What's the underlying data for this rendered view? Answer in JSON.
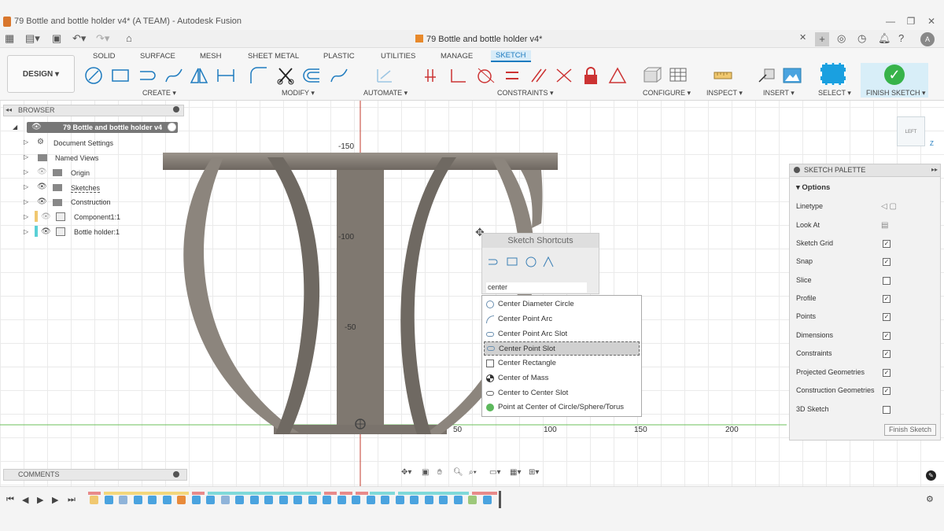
{
  "window": {
    "title": "79 Bottle and bottle holder v4* (A TEAM) - Autodesk Fusion"
  },
  "doc_tab": {
    "title": "79 Bottle and bottle holder v4*"
  },
  "ribbon": {
    "design_label": "DESIGN",
    "tabs": [
      "SOLID",
      "SURFACE",
      "MESH",
      "SHEET METAL",
      "PLASTIC",
      "UTILITIES",
      "MANAGE",
      "SKETCH"
    ],
    "active_tab": "SKETCH",
    "groups": [
      "CREATE",
      "MODIFY",
      "AUTOMATE",
      "CONSTRAINTS",
      "CONFIGURE",
      "INSPECT",
      "INSERT",
      "SELECT",
      "FINISH SKETCH"
    ]
  },
  "browser": {
    "title": "BROWSER",
    "root": "79 Bottle and bottle holder v4",
    "items": [
      "Document Settings",
      "Named Views",
      "Origin",
      "Sketches",
      "Construction",
      "Component1:1",
      "Bottle holder:1"
    ]
  },
  "comments": {
    "title": "COMMENTS"
  },
  "sketch_palette": {
    "title": "SKETCH PALETTE",
    "section": "Options",
    "rows": [
      {
        "label": "Linetype",
        "checked": null
      },
      {
        "label": "Look At",
        "checked": null
      },
      {
        "label": "Sketch Grid",
        "checked": true
      },
      {
        "label": "Snap",
        "checked": true
      },
      {
        "label": "Slice",
        "checked": false
      },
      {
        "label": "Profile",
        "checked": true
      },
      {
        "label": "Points",
        "checked": true
      },
      {
        "label": "Dimensions",
        "checked": true
      },
      {
        "label": "Constraints",
        "checked": true
      },
      {
        "label": "Projected Geometries",
        "checked": true
      },
      {
        "label": "Construction Geometries",
        "checked": true
      },
      {
        "label": "3D Sketch",
        "checked": false
      }
    ],
    "finish_label": "Finish Sketch"
  },
  "shortcuts": {
    "title": "Sketch Shortcuts",
    "search_value": "center",
    "results": [
      "Center Diameter Circle",
      "Center Point Arc",
      "Center Point Arc Slot",
      "Center Point Slot",
      "Center Rectangle",
      "Center of Mass",
      "Center to Center Slot",
      "Point at Center of Circle/Sphere/Torus"
    ],
    "selected": "Center Point Slot"
  },
  "axis_labels": {
    "y": [
      "-150",
      "-100",
      "-50"
    ],
    "x": [
      "50",
      "100",
      "150",
      "200"
    ]
  },
  "viewcube": {
    "label": "LEFT",
    "axis": "Z"
  },
  "colors": {
    "accent": "#1e7bbf",
    "finish": "#37b34a",
    "part": "#8a837c"
  }
}
